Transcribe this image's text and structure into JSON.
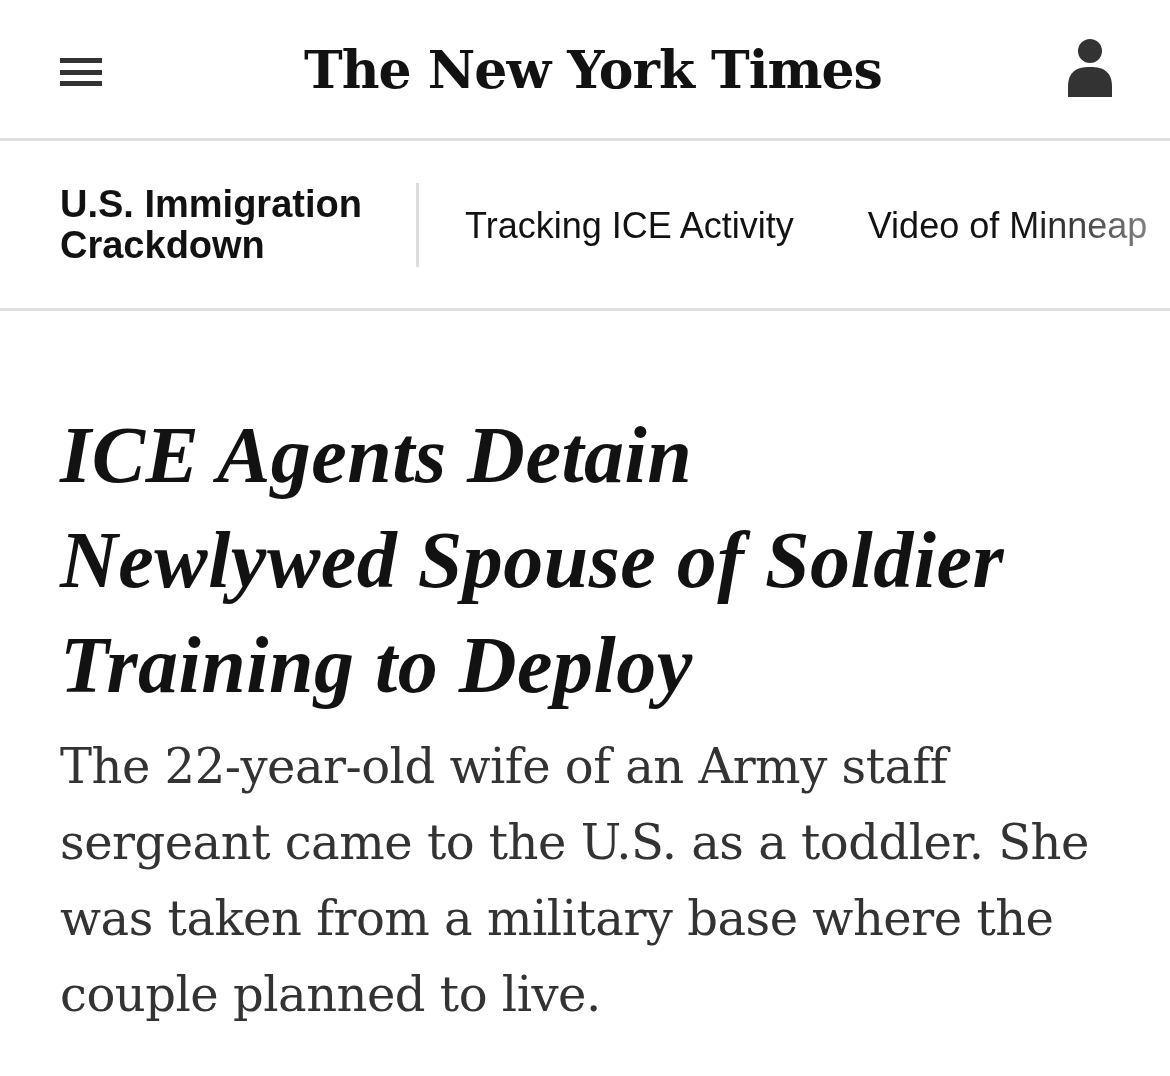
{
  "header": {
    "logo": "The New York Times"
  },
  "section_nav": {
    "section": "U.S. Immigration Crackdown",
    "links": [
      "Tracking ICE Activity",
      "Video of Minneap"
    ]
  },
  "article": {
    "headline": "ICE Agents Detain Newlywed Spouse of Soldier Training to Deploy",
    "summary": "The 22-year-old wife of an Army staff sergeant came to the U.S. as a toddler. She was taken from a military base where the couple planned to live."
  }
}
